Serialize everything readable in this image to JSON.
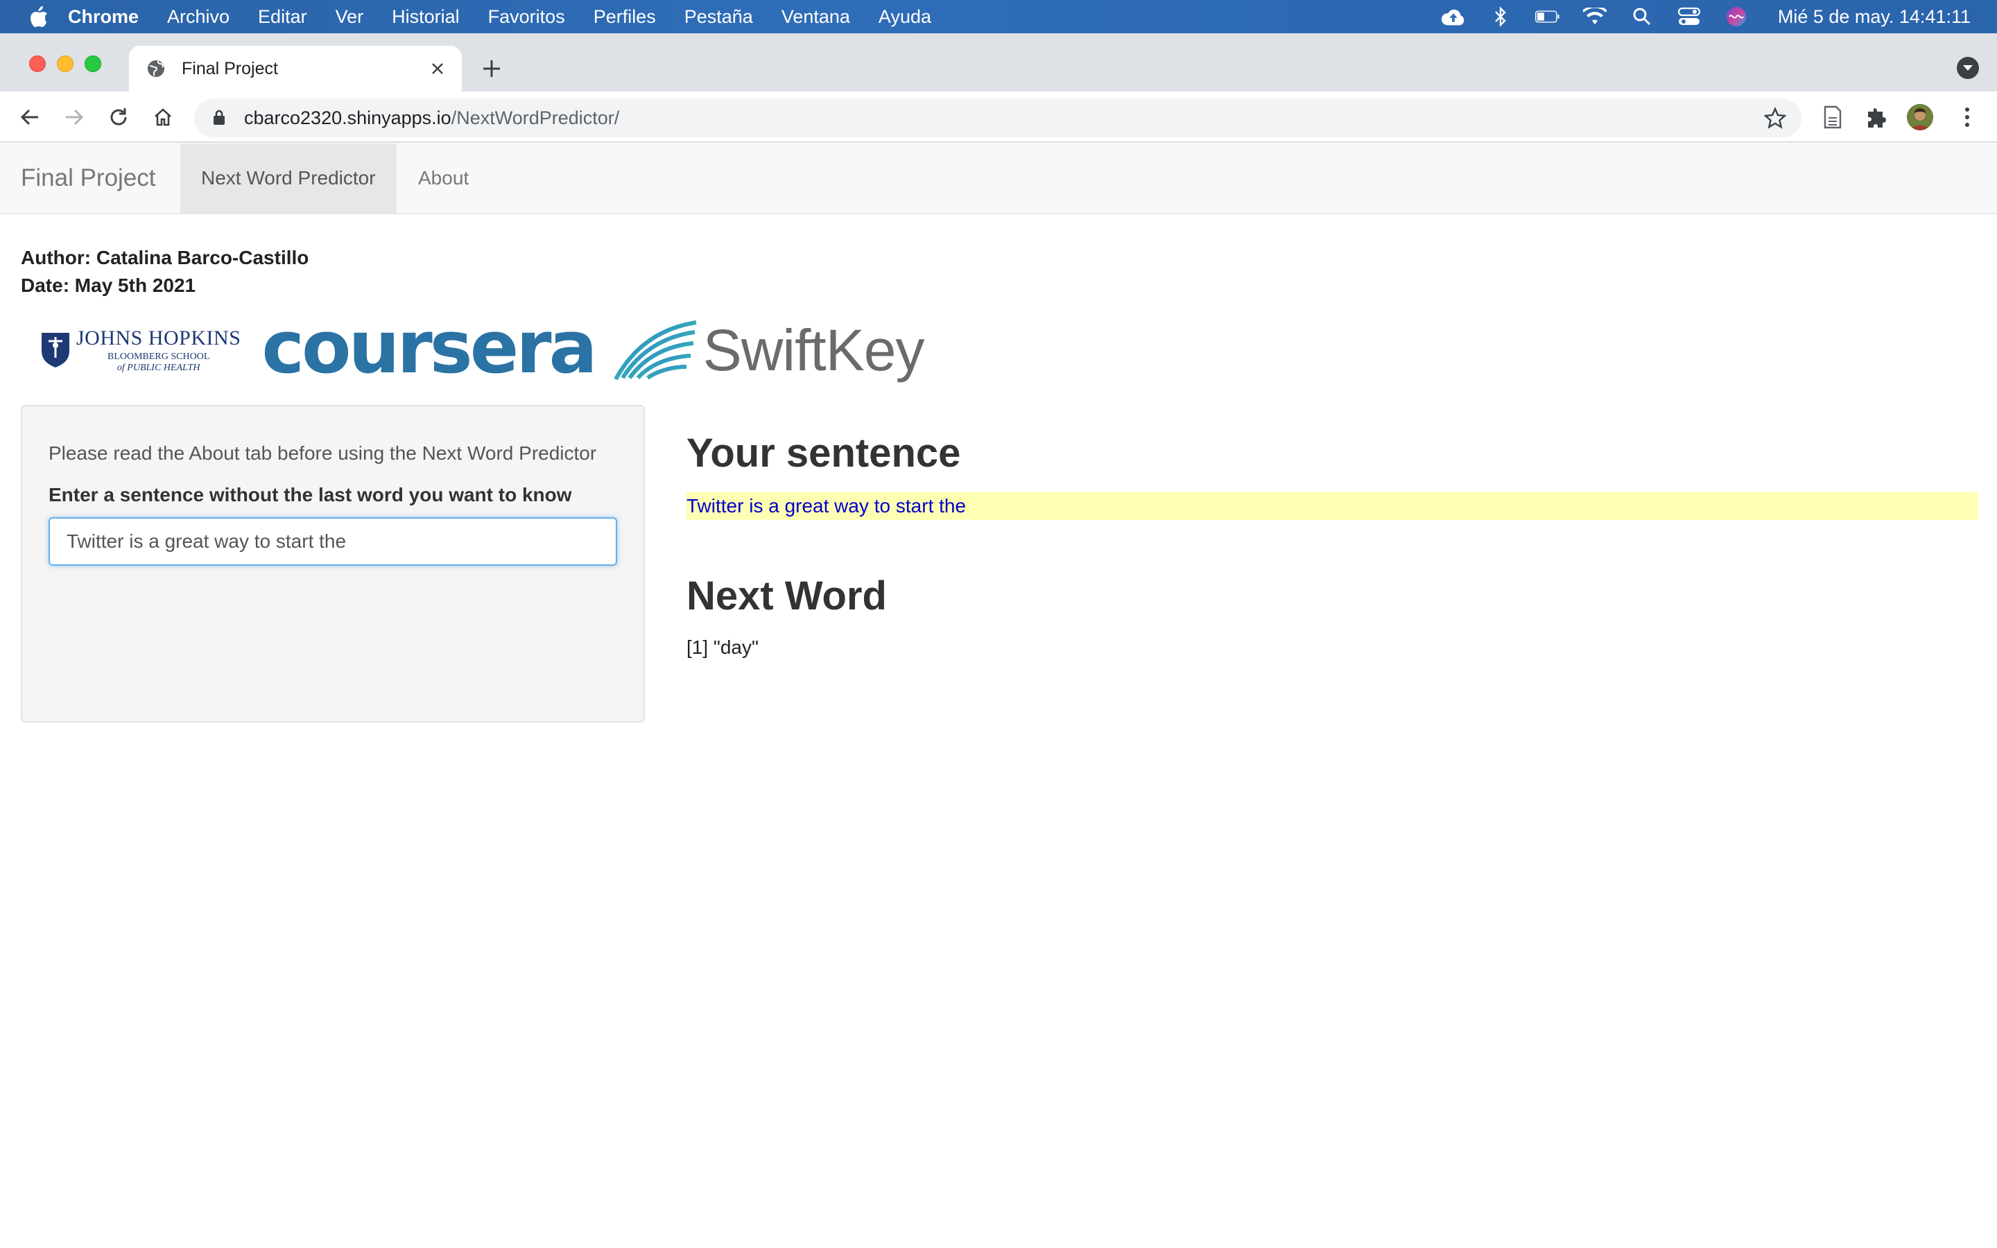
{
  "menubar": {
    "app_name": "Chrome",
    "items": [
      "Archivo",
      "Editar",
      "Ver",
      "Historial",
      "Favoritos",
      "Perfiles",
      "Pestaña",
      "Ventana",
      "Ayuda"
    ],
    "clock": "Mié 5 de may.  14:41:11",
    "status_icons": [
      "cloud-upload-icon",
      "bluetooth-icon",
      "battery-icon",
      "wifi-icon",
      "spotlight-search-icon",
      "control-center-icon",
      "siri-icon"
    ]
  },
  "browser": {
    "tab_title": "Final Project",
    "url_host": "cbarco2320.shinyapps.io",
    "url_path": "/NextWordPredictor/"
  },
  "navbar": {
    "brand": "Final Project",
    "tabs": [
      {
        "label": "Next Word Predictor",
        "active": true
      },
      {
        "label": "About",
        "active": false
      }
    ]
  },
  "header": {
    "author": "Author: Catalina Barco-Castillo",
    "date": "Date: May 5th 2021"
  },
  "logos": {
    "jhu_line1": "JOHNS HOPKINS",
    "jhu_line2": "BLOOMBERG SCHOOL",
    "jhu_line3": "of PUBLIC HEALTH",
    "coursera": "coursera",
    "swiftkey": "SwiftKey"
  },
  "sidebar": {
    "help_text": "Please read the About tab before using the Next Word Predictor",
    "input_label": "Enter a sentence without the last word you want to know",
    "input_value": "Twitter is a great way to start the"
  },
  "main": {
    "sentence_heading": "Your sentence",
    "sentence_output": "Twitter is a great way to start the",
    "next_heading": "Next Word",
    "next_output": "[1] \"day\""
  },
  "colors": {
    "menubar": "#2f6db8",
    "sentence_highlight": "#ffffb3",
    "sentence_text": "#0000cc",
    "input_focus": "#66afe9"
  }
}
